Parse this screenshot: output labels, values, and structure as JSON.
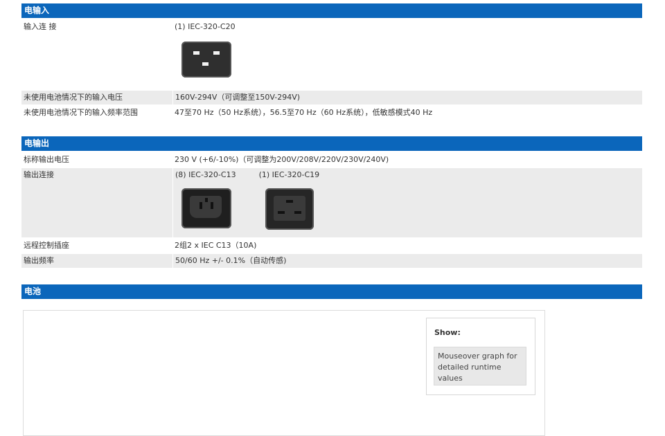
{
  "input_section": {
    "title": "电输入",
    "rows": [
      {
        "label": "输入连 接",
        "value": "(1) IEC-320-C20",
        "icon": "iec-c20-inlet-icon"
      },
      {
        "label": "未使用电池情况下的输入电压",
        "value": "160V-294V（可调整至150V-294V)"
      },
      {
        "label": "未使用电池情况下的输入频率范围",
        "value": "47至70 Hz（50 Hz系统），56.5至70 Hz（60 Hz系统），低敏感模式40 Hz"
      }
    ]
  },
  "output_section": {
    "title": "电输出",
    "rows": [
      {
        "label": "标称输出电压",
        "value": "230 V (+6/-10%)（可调整为200V/208V/220V/230V/240V)"
      },
      {
        "label": "输出连接",
        "value_1": "(8) IEC-320-C13",
        "value_2": "(1) IEC-320-C19",
        "icons": [
          "iec-c13-outlet-icon",
          "iec-c19-outlet-icon"
        ]
      },
      {
        "label": "远程控制插座",
        "value": "2组2 x IEC C13（10A)"
      },
      {
        "label": "输出频率",
        "value": "50/60 Hz +/- 0.1%（自动传感)"
      }
    ]
  },
  "battery_section": {
    "title": "电池",
    "show_label": "Show:",
    "hint": "Mouseover graph for detailed runtime values"
  }
}
